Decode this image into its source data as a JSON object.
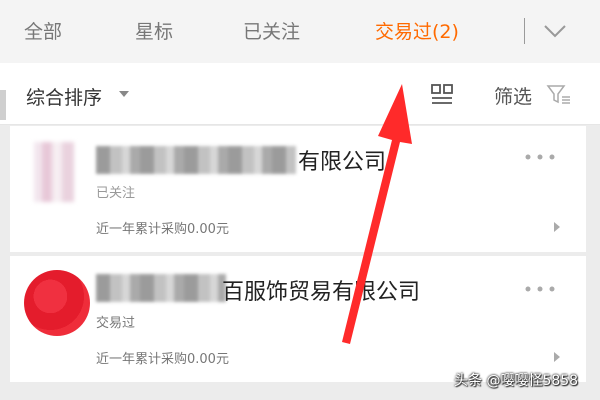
{
  "tabs": [
    {
      "label": "全部",
      "active": false
    },
    {
      "label": "星标",
      "active": false
    },
    {
      "label": "已关注",
      "active": false
    },
    {
      "label": "交易过(2)",
      "active": true
    }
  ],
  "tab_chevron_icon": "chevron-down-icon",
  "sortbar": {
    "sort_label": "综合排序",
    "layout_icon": "grid-layout-icon",
    "filter_label": "筛选",
    "filter_icon": "filter-icon"
  },
  "suppliers": [
    {
      "name_visible": "有限公司",
      "status": "已关注",
      "purchase": "近一年累计采购0.00元"
    },
    {
      "name_visible": "百服饰贸易有限公司",
      "status": "交易过",
      "purchase": "近一年累计采购0.00元"
    }
  ],
  "colors": {
    "accent": "#ff6a00",
    "annotation": "#ff2a2a"
  },
  "watermark": "头条 @嘤嘤怪5858"
}
